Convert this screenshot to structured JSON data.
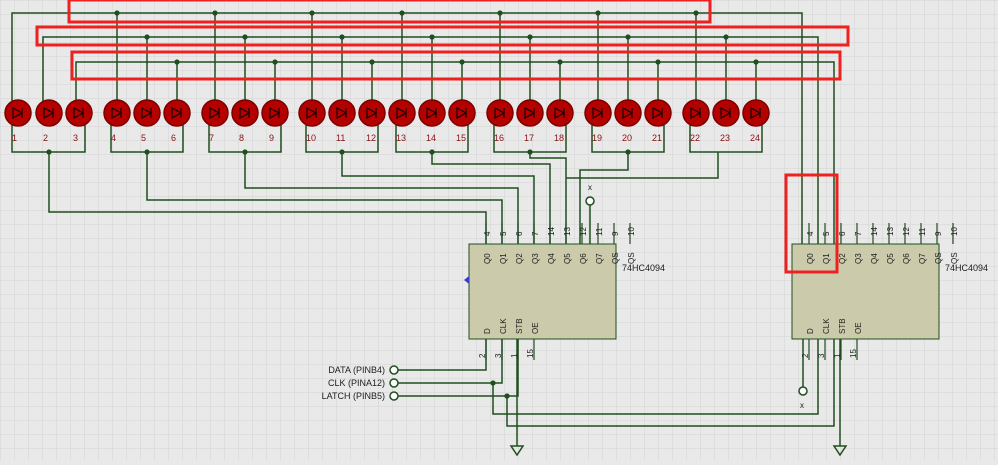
{
  "leds": {
    "labels": [
      "1",
      "2",
      "3",
      "4",
      "5",
      "6",
      "7",
      "8",
      "9",
      "10",
      "11",
      "12",
      "13",
      "14",
      "15",
      "16",
      "17",
      "18",
      "19",
      "20",
      "21",
      "22",
      "23",
      "24"
    ]
  },
  "chips": [
    {
      "name": "74HC4094",
      "top_pin_numbers": [
        "4",
        "5",
        "6",
        "7",
        "14",
        "13",
        "12",
        "11",
        "9",
        "10"
      ],
      "top_pin_names": [
        "Q0",
        "Q1",
        "Q2",
        "Q3",
        "Q4",
        "Q5",
        "Q6",
        "Q7",
        "QS",
        "QS"
      ],
      "bottom_pin_numbers": [
        "2",
        "3",
        "1",
        "15"
      ],
      "bottom_pin_names": [
        "D",
        "CLK",
        "STB",
        "OE"
      ]
    },
    {
      "name": "74HC4094",
      "top_pin_numbers": [
        "4",
        "5",
        "6",
        "7",
        "14",
        "13",
        "12",
        "11",
        "9",
        "10"
      ],
      "top_pin_names": [
        "Q0",
        "Q1",
        "Q2",
        "Q3",
        "Q4",
        "Q5",
        "Q6",
        "Q7",
        "QS",
        "QS"
      ],
      "bottom_pin_numbers": [
        "2",
        "3",
        "1",
        "15"
      ],
      "bottom_pin_names": [
        "D",
        "CLK",
        "STB",
        "OE"
      ]
    }
  ],
  "ports": [
    {
      "label": "DATA (PINB4)"
    },
    {
      "label": "CLK  (PINA12)"
    },
    {
      "label": "LATCH (PINB5)"
    }
  ],
  "no_connect": "x",
  "colors": {
    "background": "#e9e9e9",
    "grid": "#d2d2d2",
    "wire": "#1f4f1f",
    "chip_fill": "#cbcbab",
    "chip_text": "#202020",
    "led_fill": "#b50000",
    "led_ring": "#7a0000",
    "label_red": "#8a1010",
    "highlight": "#ee2020"
  }
}
